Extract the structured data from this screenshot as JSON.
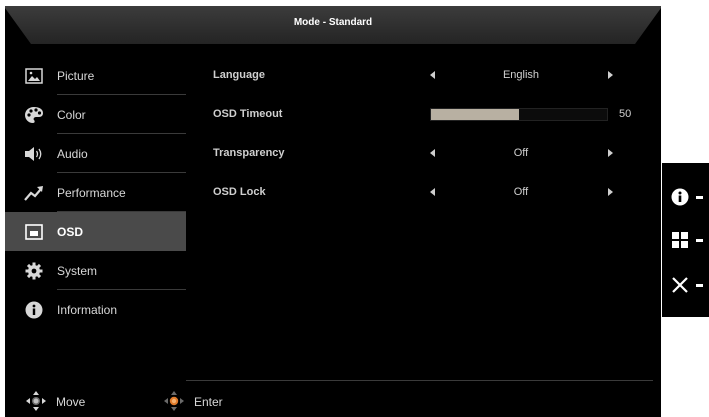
{
  "header": {
    "title": "Mode - Standard"
  },
  "sidebar": {
    "items": [
      {
        "label": "Picture",
        "icon": "picture-icon",
        "active": false
      },
      {
        "label": "Color",
        "icon": "palette-icon",
        "active": false
      },
      {
        "label": "Audio",
        "icon": "speaker-icon",
        "active": false
      },
      {
        "label": "Performance",
        "icon": "trend-arrow-icon",
        "active": false
      },
      {
        "label": "OSD",
        "icon": "osd-window-icon",
        "active": true
      },
      {
        "label": "System",
        "icon": "gear-icon",
        "active": false
      },
      {
        "label": "Information",
        "icon": "info-icon",
        "active": false
      }
    ]
  },
  "settings": [
    {
      "label": "Language",
      "type": "select",
      "value": "English"
    },
    {
      "label": "OSD Timeout",
      "type": "slider",
      "value": "50",
      "percent": 50
    },
    {
      "label": "Transparency",
      "type": "select",
      "value": "Off"
    },
    {
      "label": "OSD Lock",
      "type": "select",
      "value": "Off"
    }
  ],
  "footer": {
    "move_label": "Move",
    "enter_label": "Enter"
  },
  "keys": [
    {
      "icon": "info-icon"
    },
    {
      "icon": "grid-icon"
    },
    {
      "icon": "close-icon"
    }
  ],
  "colors": {
    "background": "#000000",
    "active_item": "#4a4a4a",
    "slider_fill": "#b8b0a2",
    "text": "#d8d8d8"
  }
}
